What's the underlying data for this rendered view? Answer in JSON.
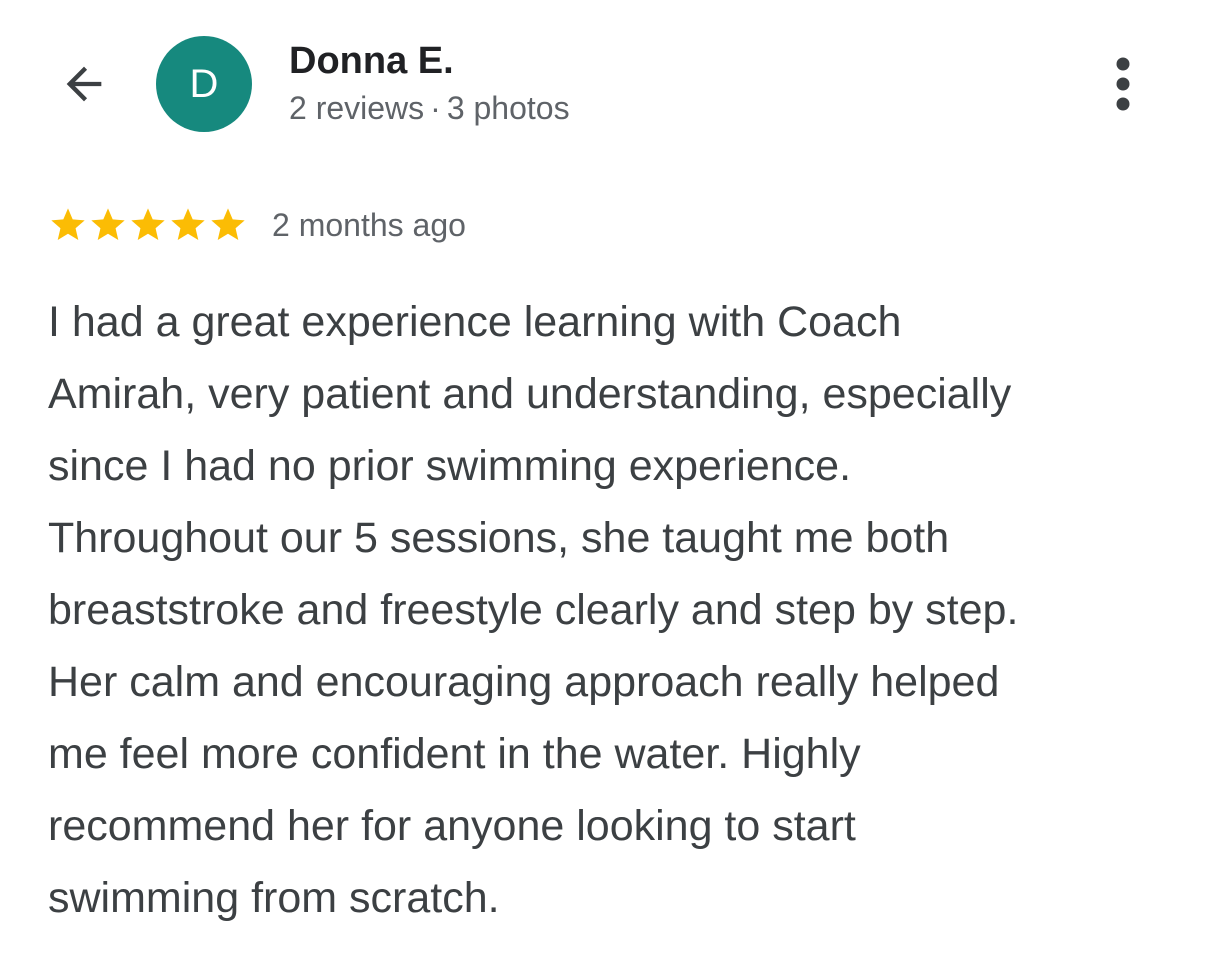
{
  "header": {
    "back_icon": "arrow-left-icon",
    "avatar_letter": "D",
    "avatar_color": "#16897e",
    "reviewer_name": "Donna E.",
    "reviews_count": "2 reviews",
    "separator": "·",
    "photos_count": "3 photos",
    "more_icon": "more-vert-icon"
  },
  "review": {
    "rating": 5,
    "max_rating": 5,
    "star_color": "#fbbc04",
    "time_ago": "2 months ago",
    "text": "I had a great experience learning with Coach\nAmirah, very patient and understanding, especially\nsince I had no prior swimming experience.\nThroughout our 5 sessions, she taught me both\nbreaststroke and freestyle clearly and step by step.\nHer calm and encouraging approach really helped\nme feel more confident in the water. Highly\nrecommend her for anyone looking to start\nswimming from scratch."
  }
}
